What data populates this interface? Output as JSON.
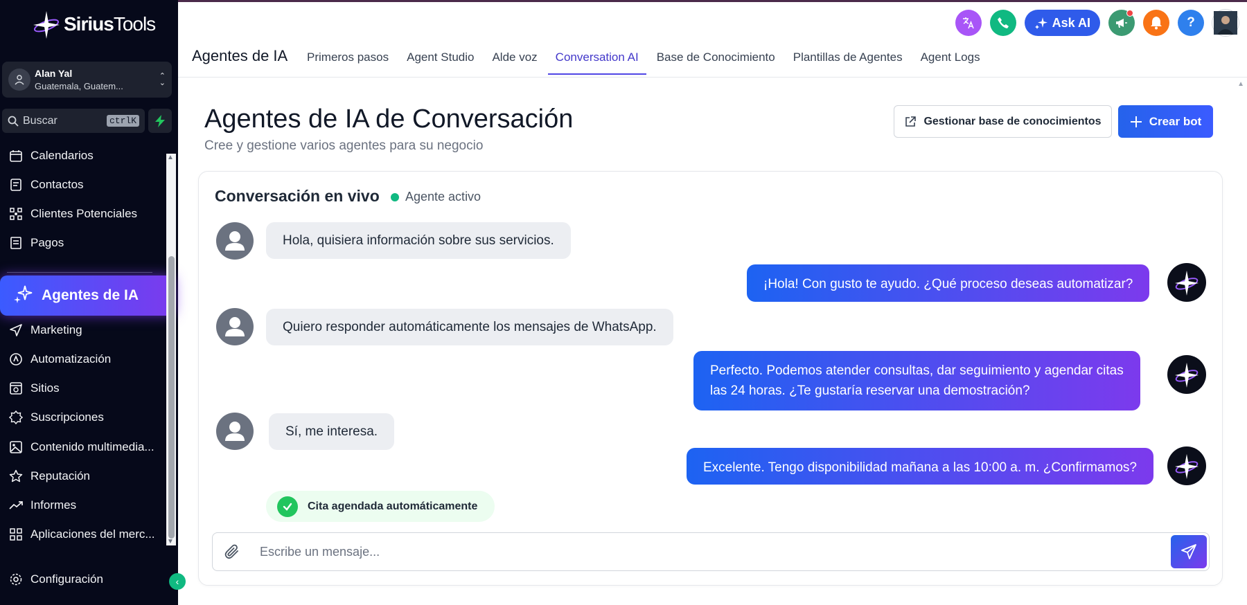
{
  "brand": {
    "name_bold": "Sirius",
    "name_light": "Tools"
  },
  "account": {
    "name": "Alan Yal",
    "location": "Guatemala, Guatem..."
  },
  "search": {
    "label": "Buscar",
    "shortcut": "ctrlK"
  },
  "sidebar": {
    "items": [
      {
        "label": "Calendarios",
        "icon": "calendar-icon"
      },
      {
        "label": "Contactos",
        "icon": "contacts-icon"
      },
      {
        "label": "Clientes Potenciales",
        "icon": "leads-icon"
      },
      {
        "label": "Pagos",
        "icon": "payments-icon"
      },
      {
        "label": "Agentes de IA",
        "icon": "sparkles-icon",
        "active": true
      },
      {
        "label": "Marketing",
        "icon": "send-icon"
      },
      {
        "label": "Automatización",
        "icon": "automation-icon"
      },
      {
        "label": "Sitios",
        "icon": "sites-icon"
      },
      {
        "label": "Suscripciones",
        "icon": "badge-icon"
      },
      {
        "label": "Contenido multimedia...",
        "icon": "image-icon"
      },
      {
        "label": "Reputación",
        "icon": "star-icon"
      },
      {
        "label": "Informes",
        "icon": "trend-icon"
      },
      {
        "label": "Aplicaciones del merc...",
        "icon": "apps-icon"
      }
    ],
    "settings_label": "Configuración"
  },
  "topbar": {
    "ask_ai": "Ask AI",
    "help": "?"
  },
  "header": {
    "title": "Agentes de IA",
    "tabs": [
      {
        "label": "Primeros pasos"
      },
      {
        "label": "Agent Studio"
      },
      {
        "label": "Alde voz"
      },
      {
        "label": "Conversation AI",
        "active": true
      },
      {
        "label": "Base de Conocimiento"
      },
      {
        "label": "Plantillas de Agentes"
      },
      {
        "label": "Agent Logs"
      }
    ]
  },
  "page": {
    "title": "Agentes de IA de Conversación",
    "subtitle": "Cree y gestione varios agentes para su negocio",
    "manage_kb_button": "Gestionar base de conocimientos",
    "create_bot_button": "Crear bot"
  },
  "chat": {
    "title": "Conversación en vivo",
    "status": "Agente activo",
    "messages": [
      {
        "from": "user",
        "text": "Hola, quisiera información sobre sus servicios."
      },
      {
        "from": "bot",
        "text": "¡Hola! Con gusto te ayudo. ¿Qué proceso deseas automatizar?"
      },
      {
        "from": "user",
        "text": "Quiero responder automáticamente los mensajes de WhatsApp."
      },
      {
        "from": "bot",
        "line1": "Perfecto. Podemos atender consultas, dar seguimiento y agendar citas",
        "line2": "las 24 horas. ¿Te gustaría reservar una demostración?"
      },
      {
        "from": "user",
        "text": "Sí, me interesa."
      },
      {
        "from": "bot",
        "text": "Excelente. Tengo disponibilidad mañana a las 10:00 a. m. ¿Confirmamos?"
      }
    ],
    "confirmation": "Cita agendada automáticamente",
    "input_placeholder": "Escribe un mensaje..."
  },
  "colors": {
    "sidebar_bg": "#06091a",
    "accent_blue": "#2563eb",
    "accent_purple": "#7c3aed",
    "status_green": "#10b981"
  }
}
